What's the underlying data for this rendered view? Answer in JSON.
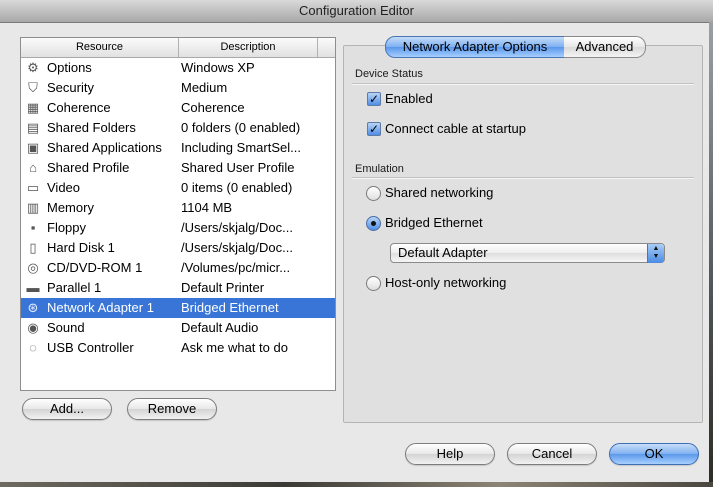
{
  "window": {
    "title": "Configuration Editor"
  },
  "list": {
    "headers": {
      "resource": "Resource",
      "description": "Description"
    },
    "rows": [
      {
        "icon": "gear-icon",
        "glyph": "⚙",
        "name": "Options",
        "description": "Windows XP"
      },
      {
        "icon": "shield-icon",
        "glyph": "⛉",
        "name": "Security",
        "description": "Medium"
      },
      {
        "icon": "coherence-icon",
        "glyph": "▦",
        "name": "Coherence",
        "description": "Coherence"
      },
      {
        "icon": "folder-icon",
        "glyph": "▤",
        "name": "Shared Folders",
        "description": "0 folders (0 enabled)"
      },
      {
        "icon": "applications-icon",
        "glyph": "▣",
        "name": "Shared Applications",
        "description": "Including SmartSel..."
      },
      {
        "icon": "home-icon",
        "glyph": "⌂",
        "name": "Shared Profile",
        "description": "Shared User Profile"
      },
      {
        "icon": "monitor-icon",
        "glyph": "▭",
        "name": "Video",
        "description": "0 items (0 enabled)"
      },
      {
        "icon": "memory-icon",
        "glyph": "▥",
        "name": "Memory",
        "description": "1104 MB"
      },
      {
        "icon": "floppy-icon",
        "glyph": "▪",
        "name": "Floppy",
        "description": "/Users/skjalg/Doc..."
      },
      {
        "icon": "hard-disk-icon",
        "glyph": "▯",
        "name": "Hard Disk 1",
        "description": "/Users/skjalg/Doc..."
      },
      {
        "icon": "cd-icon",
        "glyph": "◎",
        "name": "CD/DVD-ROM 1",
        "description": "/Volumes/pc/micr..."
      },
      {
        "icon": "printer-icon",
        "glyph": "▬",
        "name": "Parallel 1",
        "description": "Default Printer"
      },
      {
        "icon": "network-icon",
        "glyph": "⊛",
        "name": "Network Adapter 1",
        "description": "Bridged Ethernet",
        "selected": true
      },
      {
        "icon": "speaker-icon",
        "glyph": "◉",
        "name": "Sound",
        "description": "Default Audio"
      },
      {
        "icon": "usb-icon",
        "glyph": "◌",
        "name": "USB Controller",
        "description": "Ask me what to do"
      }
    ]
  },
  "list_buttons": {
    "add": "Add...",
    "remove": "Remove"
  },
  "tabs": {
    "active": "Network Adapter Options",
    "other": "Advanced"
  },
  "device_status": {
    "label": "Device Status",
    "enabled": {
      "label": "Enabled",
      "checked": true
    },
    "connect_cable": {
      "label": "Connect cable at startup",
      "checked": true
    }
  },
  "emulation": {
    "label": "Emulation",
    "shared": {
      "label": "Shared networking",
      "selected": false
    },
    "bridged": {
      "label": "Bridged Ethernet",
      "selected": true
    },
    "adapter_select": {
      "value": "Default Adapter"
    },
    "host_only": {
      "label": "Host-only networking",
      "selected": false
    }
  },
  "footer": {
    "help": "Help",
    "cancel": "Cancel",
    "ok": "OK"
  },
  "colors": {
    "selection": "#3875d7",
    "accent": "#5b98ea"
  }
}
